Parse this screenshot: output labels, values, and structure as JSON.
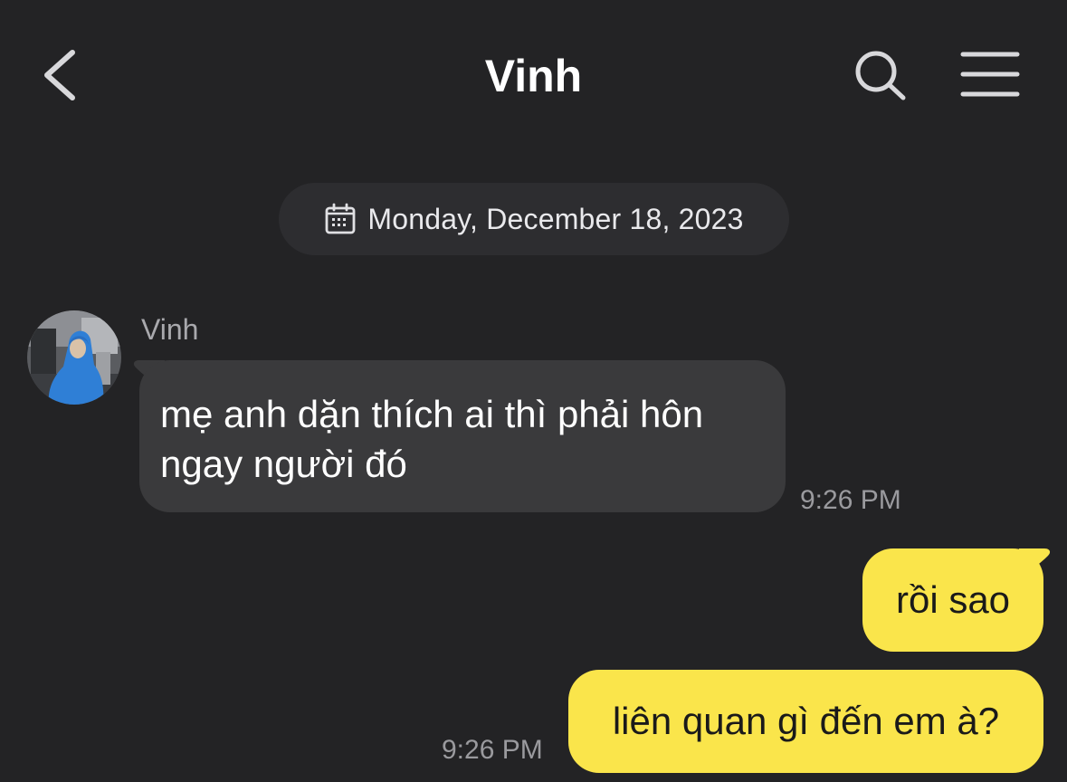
{
  "header": {
    "title": "Vinh",
    "back_icon": "chevron-left-icon",
    "search_icon": "search-icon",
    "menu_icon": "hamburger-menu-icon"
  },
  "date_divider": {
    "icon": "calendar-icon",
    "text": "Monday, December 18, 2023"
  },
  "messages": [
    {
      "direction": "incoming",
      "sender": "Vinh",
      "text": "mẹ anh dặn thích ai thì phải hôn ngay người đó",
      "time": "9:26 PM"
    },
    {
      "direction": "outgoing",
      "text": "rồi sao"
    },
    {
      "direction": "outgoing",
      "text": "liên quan gì đến em à?",
      "time": "9:26 PM"
    }
  ],
  "colors": {
    "background": "#232325",
    "incoming_bubble": "#3a3a3c",
    "outgoing_bubble": "#fae54b",
    "timestamp": "#9a9a9e",
    "sender_name": "#a9a9ad"
  }
}
